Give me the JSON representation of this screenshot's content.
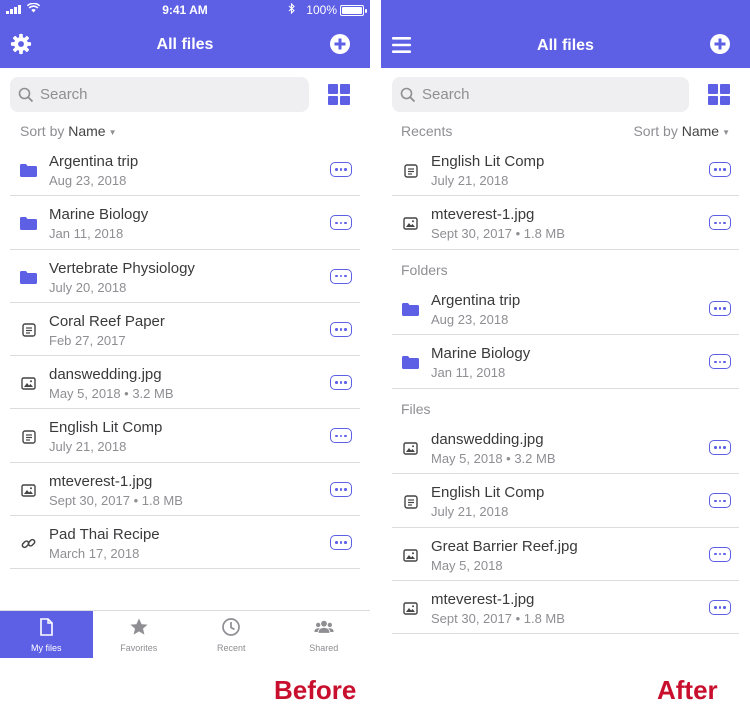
{
  "colors": {
    "accent": "#5d5fe5",
    "caption": "#c8102e"
  },
  "before": {
    "status": {
      "time": "9:41 AM",
      "battery": "100%"
    },
    "title": "All files",
    "search_placeholder": "Search",
    "sort": {
      "prefix": "Sort by",
      "value": "Name"
    },
    "items": [
      {
        "icon": "folder-icon",
        "name": "Argentina trip",
        "meta": "Aug 23, 2018"
      },
      {
        "icon": "folder-icon",
        "name": "Marine Biology",
        "meta": "Jan 11, 2018"
      },
      {
        "icon": "folder-icon",
        "name": "Vertebrate Physiology",
        "meta": "July 20, 2018"
      },
      {
        "icon": "document-icon",
        "name": "Coral Reef Paper",
        "meta": "Feb 27, 2017"
      },
      {
        "icon": "image-icon",
        "name": "danswedding.jpg",
        "meta": "May 5, 2018 • 3.2 MB"
      },
      {
        "icon": "document-icon",
        "name": "English Lit Comp",
        "meta": "July 21, 2018"
      },
      {
        "icon": "image-icon",
        "name": "mteverest-1.jpg",
        "meta": "Sept 30, 2017 • 1.8 MB"
      },
      {
        "icon": "link-icon",
        "name": "Pad Thai Recipe",
        "meta": "March 17, 2018"
      }
    ],
    "tabs": [
      {
        "label": "My files",
        "icon": "file-icon"
      },
      {
        "label": "Favorites",
        "icon": "star-icon"
      },
      {
        "label": "Recent",
        "icon": "clock-icon"
      },
      {
        "label": "Shared",
        "icon": "people-icon"
      }
    ],
    "caption": "Before"
  },
  "after": {
    "title": "All files",
    "search_placeholder": "Search",
    "sort": {
      "prefix": "Sort by",
      "value": "Name"
    },
    "sections": [
      {
        "label": "Recents",
        "items": [
          {
            "icon": "document-icon",
            "name": "English Lit Comp",
            "meta": "July 21, 2018"
          },
          {
            "icon": "image-icon",
            "name": "mteverest-1.jpg",
            "meta": "Sept 30, 2017 • 1.8 MB"
          }
        ]
      },
      {
        "label": "Folders",
        "items": [
          {
            "icon": "folder-icon",
            "name": "Argentina trip",
            "meta": "Aug 23, 2018"
          },
          {
            "icon": "folder-icon",
            "name": "Marine Biology",
            "meta": "Jan 11, 2018"
          }
        ]
      },
      {
        "label": "Files",
        "items": [
          {
            "icon": "image-icon",
            "name": "danswedding.jpg",
            "meta": "May 5, 2018 • 3.2 MB"
          },
          {
            "icon": "document-icon",
            "name": "English Lit Comp",
            "meta": "July 21, 2018"
          },
          {
            "icon": "image-icon",
            "name": "Great Barrier Reef.jpg",
            "meta": "May 5, 2018"
          },
          {
            "icon": "image-icon",
            "name": "mteverest-1.jpg",
            "meta": "Sept 30, 2017 • 1.8 MB"
          }
        ]
      }
    ],
    "caption": "After"
  }
}
